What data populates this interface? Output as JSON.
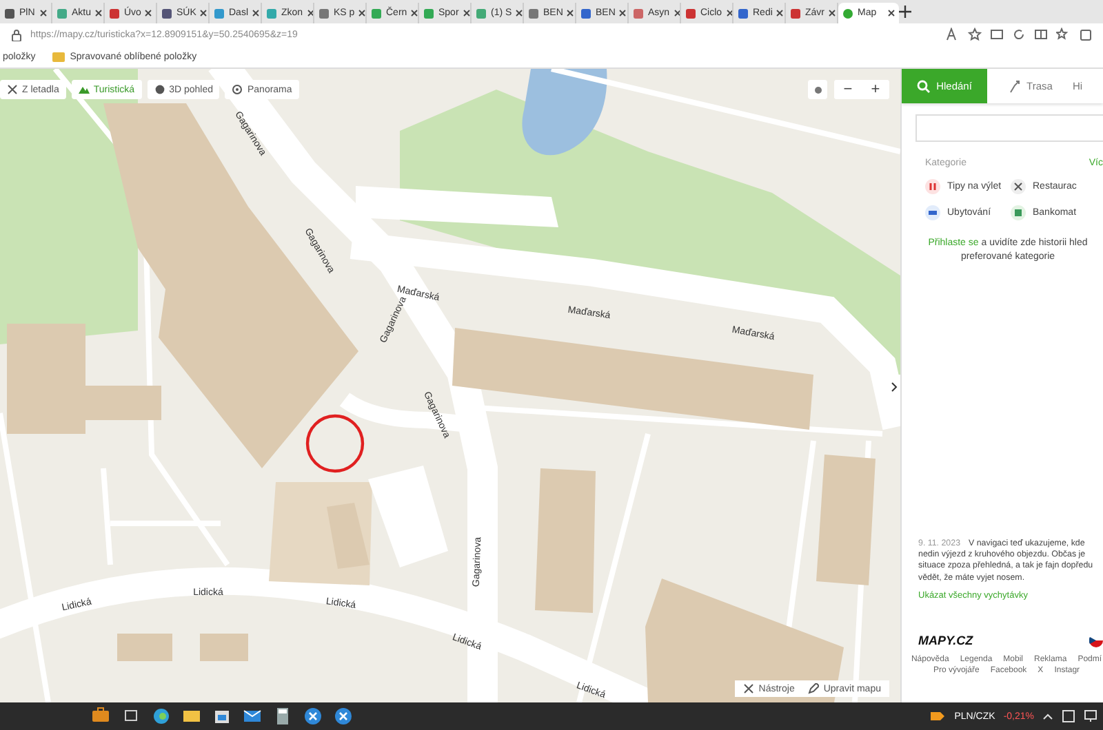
{
  "browser": {
    "tabs": [
      {
        "label": "PlN",
        "selected": false
      },
      {
        "label": "Aktu",
        "selected": false
      },
      {
        "label": "Úvo",
        "selected": false
      },
      {
        "label": "SÚK",
        "selected": false
      },
      {
        "label": "Dasl",
        "selected": false
      },
      {
        "label": "Zkon",
        "selected": false
      },
      {
        "label": "KS p",
        "selected": false
      },
      {
        "label": "Čern",
        "selected": false
      },
      {
        "label": "Spor",
        "selected": false
      },
      {
        "label": "(1) S",
        "selected": false
      },
      {
        "label": "BEN",
        "selected": false
      },
      {
        "label": "BEN",
        "selected": false
      },
      {
        "label": "Asyn",
        "selected": false
      },
      {
        "label": "Ciclo",
        "selected": false
      },
      {
        "label": "Redi",
        "selected": false
      },
      {
        "label": "Závr",
        "selected": false
      },
      {
        "label": "Map",
        "selected": true
      }
    ],
    "address": "https://mapy.cz/turisticka?x=12.8909151&y=50.2540695&z=19",
    "favorites": [
      "položky",
      "Spravované oblíbené položky"
    ]
  },
  "map": {
    "layers": [
      {
        "label": "Z letadla",
        "selected": false
      },
      {
        "label": "Turistická",
        "selected": true
      },
      {
        "label": "3D pohled",
        "selected": false
      },
      {
        "label": "Panorama",
        "selected": false
      }
    ],
    "zoom_out": "−",
    "zoom_in": "+",
    "streets": [
      "Gagarinova",
      "Gagarinova",
      "Gagarinova",
      "Maďarská",
      "Maďarská",
      "Maďarská",
      "Gagarinova",
      "Gagarinova",
      "Lidická",
      "Lidická",
      "Lidická",
      "Lidická",
      "Lidická"
    ],
    "tools": [
      "Nástroje",
      "Upravit mapu"
    ]
  },
  "panel": {
    "tabs": [
      {
        "label": "Hledání",
        "selected": true
      },
      {
        "label": "Trasa",
        "selected": false
      },
      {
        "label": "Hi",
        "selected": false
      }
    ],
    "categories_title": "Kategorie",
    "more": "Víc",
    "categories": [
      "Tipy na výlet",
      "Restaurac",
      "Ubytování",
      "Bankomat"
    ],
    "login_link": "Přihlaste se",
    "login_text": "a uvidíte zde historii hled preferované kategorie",
    "news_date": "9. 11. 2023",
    "news_text": "V navigaci teď ukazujeme, kde nedin výjezd z kruhového objezdu. Občas je situace zpoza přehledná, a tak je fajn dopředu vědět, že máte vyjet nosem.",
    "news_link": "Ukázat všechny vychytávky",
    "logo": "MAPY.CZ",
    "footer_links": [
      "Nápověda",
      "Legenda",
      "Mobil",
      "Reklama",
      "Podmí",
      "Pro vývojáře",
      "Facebook",
      "X",
      "Instagr"
    ]
  },
  "taskbar": {
    "currency": "PLN/CZK",
    "change": "-0,21%"
  }
}
